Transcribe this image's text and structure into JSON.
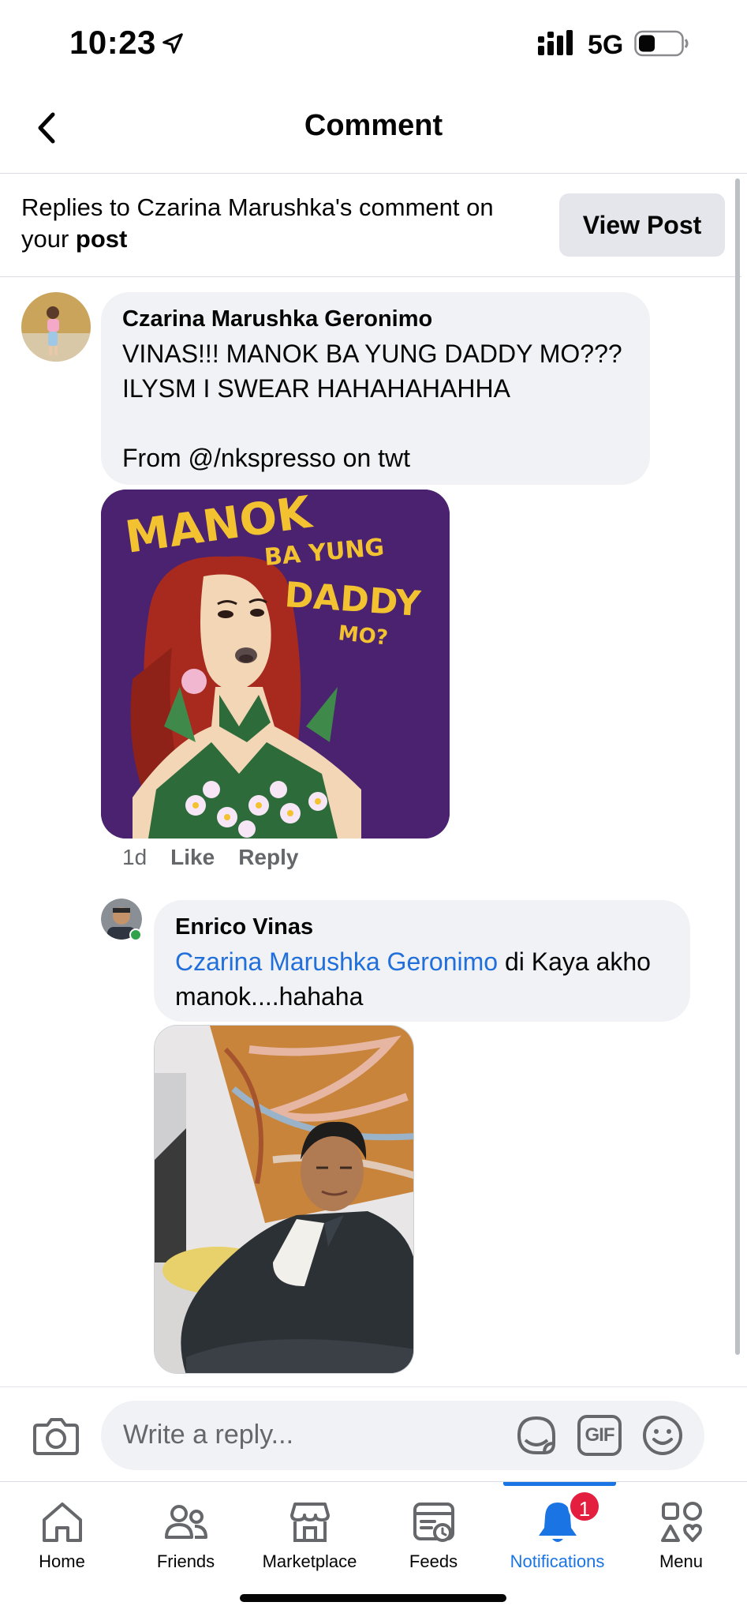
{
  "status_bar": {
    "time": "10:23",
    "network": "5G"
  },
  "header": {
    "title": "Comment",
    "back_icon": "chevron-left-icon"
  },
  "context": {
    "text_prefix": "Replies to Czarina Marushka's comment on your ",
    "text_link": "post",
    "view_post_label": "View Post"
  },
  "comments": [
    {
      "author": "Czarina Marushka Geronimo",
      "text": "VINAS!!! MANOK BA YUNG DADDY MO???\nILYSM I SWEAR HAHAHAHAHHA\n\nFrom @/nkspresso on twt",
      "sticker_text": [
        "MANOK",
        "BA YUNG",
        "DADDY",
        "MO?"
      ],
      "time": "1d",
      "like_label": "Like",
      "reply_label": "Reply"
    },
    {
      "author": "Enrico Vinas",
      "mention": "Czarina Marushka Geronimo",
      "text_after_mention": " di Kaya akho manok....hahaha",
      "online": true
    }
  ],
  "composer": {
    "placeholder": "Write a reply...",
    "icons": [
      "camera-icon",
      "sticker-icon",
      "gif-icon",
      "emoji-icon"
    ],
    "gif_label": "GIF"
  },
  "bottom_nav": {
    "items": [
      {
        "label": "Home",
        "icon": "home-icon"
      },
      {
        "label": "Friends",
        "icon": "friends-icon"
      },
      {
        "label": "Marketplace",
        "icon": "marketplace-icon"
      },
      {
        "label": "Feeds",
        "icon": "feeds-icon"
      },
      {
        "label": "Notifications",
        "icon": "bell-icon",
        "active": true,
        "badge": "1"
      },
      {
        "label": "Menu",
        "icon": "menu-icon"
      }
    ]
  },
  "colors": {
    "accent": "#1b74e4",
    "mention": "#216fdb",
    "badge": "#e41e3f",
    "bubble": "#f0f2f5",
    "sticker_bg": "#4a2270",
    "sticker_text": "#f2c230"
  }
}
